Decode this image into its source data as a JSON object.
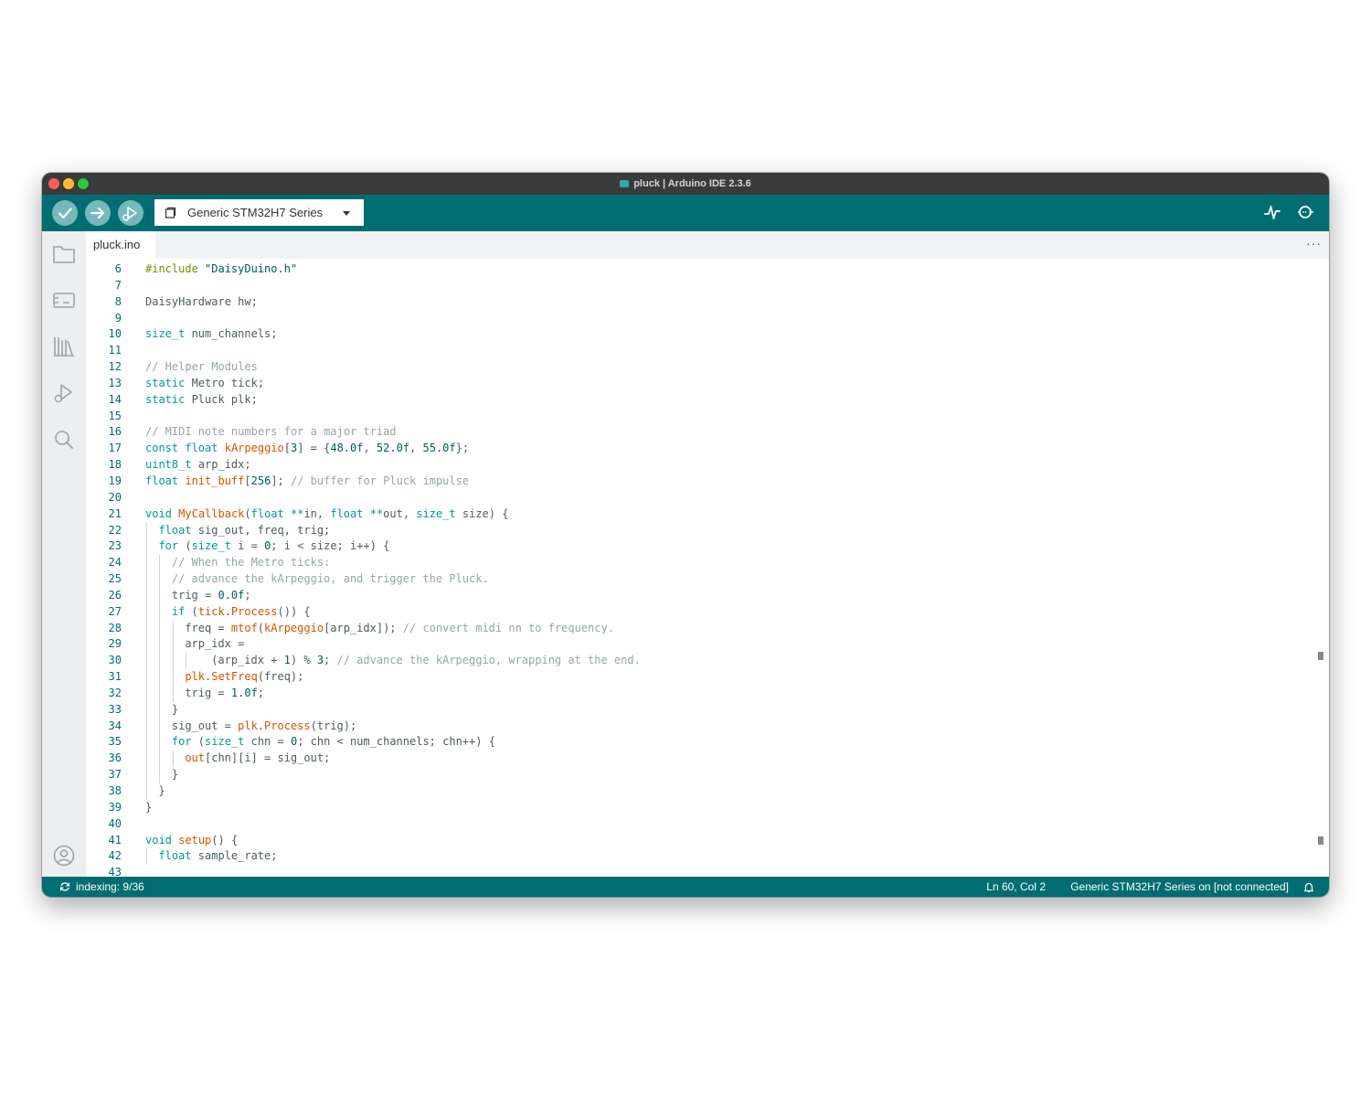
{
  "window": {
    "title": "pluck | Arduino IDE 2.3.6"
  },
  "toolbar": {
    "verify_icon": "check-icon",
    "upload_icon": "arrow-right-icon",
    "debug_icon": "debug-play-icon",
    "board_selector": "Generic STM32H7 Series",
    "serial_plotter_icon": "pulse-icon",
    "serial_monitor_icon": "magnifier-dots-icon"
  },
  "sidebar": {
    "items": [
      "folder-icon",
      "board-manager-icon",
      "library-icon",
      "debug-icon",
      "search-icon"
    ],
    "account_icon": "account-icon"
  },
  "tabs": [
    {
      "label": "pluck.ino"
    }
  ],
  "tab_more": "···",
  "editor": {
    "lines": [
      {
        "n": "6",
        "indent": 0,
        "code": [
          {
            "t": "#include ",
            "c": "pre"
          },
          {
            "t": "\"DaisyDuino.h\"",
            "c": "str"
          }
        ]
      },
      {
        "n": "7",
        "indent": 0,
        "code": []
      },
      {
        "n": "8",
        "indent": 0,
        "code": [
          {
            "t": "DaisyHardware hw;"
          }
        ]
      },
      {
        "n": "9",
        "indent": 0,
        "code": []
      },
      {
        "n": "10",
        "indent": 0,
        "code": [
          {
            "t": "size_t",
            "c": "kw"
          },
          {
            "t": " num_channels;"
          }
        ]
      },
      {
        "n": "11",
        "indent": 0,
        "code": []
      },
      {
        "n": "12",
        "indent": 0,
        "code": [
          {
            "t": "// Helper Modules",
            "c": "cmt"
          }
        ]
      },
      {
        "n": "13",
        "indent": 0,
        "code": [
          {
            "t": "static",
            "c": "kw"
          },
          {
            "t": " Metro tick;"
          }
        ]
      },
      {
        "n": "14",
        "indent": 0,
        "code": [
          {
            "t": "static",
            "c": "kw"
          },
          {
            "t": " Pluck plk;"
          }
        ]
      },
      {
        "n": "15",
        "indent": 0,
        "code": []
      },
      {
        "n": "16",
        "indent": 0,
        "code": [
          {
            "t": "// MIDI note numbers for a major triad",
            "c": "cmt"
          }
        ]
      },
      {
        "n": "17",
        "indent": 0,
        "code": [
          {
            "t": "const",
            "c": "kw"
          },
          {
            "t": " "
          },
          {
            "t": "float",
            "c": "kw"
          },
          {
            "t": " "
          },
          {
            "t": "kArpeggio",
            "c": "fn"
          },
          {
            "t": "["
          },
          {
            "t": "3",
            "c": "num"
          },
          {
            "t": "] = {"
          },
          {
            "t": "48.0f",
            "c": "num"
          },
          {
            "t": ", "
          },
          {
            "t": "52.0f",
            "c": "num"
          },
          {
            "t": ", "
          },
          {
            "t": "55.0f",
            "c": "num"
          },
          {
            "t": "};"
          }
        ]
      },
      {
        "n": "18",
        "indent": 0,
        "code": [
          {
            "t": "uint8_t",
            "c": "kw"
          },
          {
            "t": " arp_idx;"
          }
        ]
      },
      {
        "n": "19",
        "indent": 0,
        "code": [
          {
            "t": "float",
            "c": "kw"
          },
          {
            "t": " "
          },
          {
            "t": "init_buff",
            "c": "fn"
          },
          {
            "t": "["
          },
          {
            "t": "256",
            "c": "num"
          },
          {
            "t": "]; "
          },
          {
            "t": "// buffer for Pluck impulse",
            "c": "cmt"
          }
        ]
      },
      {
        "n": "20",
        "indent": 0,
        "code": []
      },
      {
        "n": "21",
        "indent": 0,
        "code": [
          {
            "t": "void",
            "c": "kw"
          },
          {
            "t": " "
          },
          {
            "t": "MyCallback",
            "c": "fn"
          },
          {
            "t": "("
          },
          {
            "t": "float",
            "c": "kw"
          },
          {
            "t": " "
          },
          {
            "t": "**",
            "c": "kw"
          },
          {
            "t": "in, "
          },
          {
            "t": "float",
            "c": "kw"
          },
          {
            "t": " "
          },
          {
            "t": "**",
            "c": "kw"
          },
          {
            "t": "out, "
          },
          {
            "t": "size_t",
            "c": "kw"
          },
          {
            "t": " size) {"
          }
        ]
      },
      {
        "n": "22",
        "indent": 1,
        "code": [
          {
            "t": "float",
            "c": "kw"
          },
          {
            "t": " sig_out, freq, trig;"
          }
        ]
      },
      {
        "n": "23",
        "indent": 1,
        "code": [
          {
            "t": "for",
            "c": "kw"
          },
          {
            "t": " ("
          },
          {
            "t": "size_t",
            "c": "kw"
          },
          {
            "t": " i = "
          },
          {
            "t": "0",
            "c": "num"
          },
          {
            "t": "; i < size; i++) {"
          }
        ]
      },
      {
        "n": "24",
        "indent": 2,
        "code": [
          {
            "t": "// When the Metro ticks:",
            "c": "cmt"
          }
        ]
      },
      {
        "n": "25",
        "indent": 2,
        "code": [
          {
            "t": "// advance the kArpeggio, and trigger the Pluck.",
            "c": "cmt"
          }
        ]
      },
      {
        "n": "26",
        "indent": 2,
        "code": [
          {
            "t": "trig = "
          },
          {
            "t": "0.0f",
            "c": "num"
          },
          {
            "t": ";"
          }
        ]
      },
      {
        "n": "27",
        "indent": 2,
        "code": [
          {
            "t": "if",
            "c": "kw"
          },
          {
            "t": " ("
          },
          {
            "t": "tick",
            "c": "fn"
          },
          {
            "t": "."
          },
          {
            "t": "Process",
            "c": "fn"
          },
          {
            "t": "()) {"
          }
        ]
      },
      {
        "n": "28",
        "indent": 3,
        "code": [
          {
            "t": "freq = "
          },
          {
            "t": "mtof",
            "c": "fn"
          },
          {
            "t": "("
          },
          {
            "t": "kArpeggio",
            "c": "fn"
          },
          {
            "t": "[arp_idx]); "
          },
          {
            "t": "// convert midi nn to frequency.",
            "c": "cmt"
          }
        ]
      },
      {
        "n": "29",
        "indent": 3,
        "code": [
          {
            "t": "arp_idx ="
          }
        ]
      },
      {
        "n": "30",
        "indent": 5,
        "code": [
          {
            "t": "(arp_idx + "
          },
          {
            "t": "1",
            "c": "num"
          },
          {
            "t": ") % "
          },
          {
            "t": "3",
            "c": "num"
          },
          {
            "t": "; "
          },
          {
            "t": "// advance the kArpeggio, wrapping at the end.",
            "c": "cmt"
          }
        ]
      },
      {
        "n": "31",
        "indent": 3,
        "code": [
          {
            "t": "plk",
            "c": "fn"
          },
          {
            "t": "."
          },
          {
            "t": "SetFreq",
            "c": "fn"
          },
          {
            "t": "(freq);"
          }
        ]
      },
      {
        "n": "32",
        "indent": 3,
        "code": [
          {
            "t": "trig = "
          },
          {
            "t": "1.0f",
            "c": "num"
          },
          {
            "t": ";"
          }
        ]
      },
      {
        "n": "33",
        "indent": 2,
        "code": [
          {
            "t": "}"
          }
        ]
      },
      {
        "n": "34",
        "indent": 2,
        "code": [
          {
            "t": "sig_out = "
          },
          {
            "t": "plk",
            "c": "fn"
          },
          {
            "t": "."
          },
          {
            "t": "Process",
            "c": "fn"
          },
          {
            "t": "(trig);"
          }
        ]
      },
      {
        "n": "35",
        "indent": 2,
        "code": [
          {
            "t": "for",
            "c": "kw"
          },
          {
            "t": " ("
          },
          {
            "t": "size_t",
            "c": "kw"
          },
          {
            "t": " chn = "
          },
          {
            "t": "0",
            "c": "num"
          },
          {
            "t": "; chn < num_channels; chn++) {"
          }
        ]
      },
      {
        "n": "36",
        "indent": 3,
        "code": [
          {
            "t": "out",
            "c": "fn"
          },
          {
            "t": "[chn][i] = sig_out;"
          }
        ]
      },
      {
        "n": "37",
        "indent": 2,
        "code": [
          {
            "t": "}"
          }
        ]
      },
      {
        "n": "38",
        "indent": 1,
        "code": [
          {
            "t": "}"
          }
        ]
      },
      {
        "n": "39",
        "indent": 0,
        "code": [
          {
            "t": "}"
          }
        ]
      },
      {
        "n": "40",
        "indent": 0,
        "code": []
      },
      {
        "n": "41",
        "indent": 0,
        "code": [
          {
            "t": "void",
            "c": "kw"
          },
          {
            "t": " "
          },
          {
            "t": "setup",
            "c": "fn"
          },
          {
            "t": "() {"
          }
        ]
      },
      {
        "n": "42",
        "indent": 1,
        "code": [
          {
            "t": "float",
            "c": "kw"
          },
          {
            "t": " sample_rate;"
          }
        ]
      },
      {
        "n": "43",
        "indent": 0,
        "code": []
      }
    ]
  },
  "status": {
    "indexing": "indexing: 9/36",
    "position": "Ln 60, Col 2",
    "board": "Generic STM32H7 Series on [not connected]",
    "bell_icon": "bell-icon"
  },
  "colors": {
    "toolbar": "#006d73",
    "toolbar_button": "#78b8bb",
    "keyword": "#00979d",
    "function": "#d35400",
    "comment": "#95a5a6"
  }
}
